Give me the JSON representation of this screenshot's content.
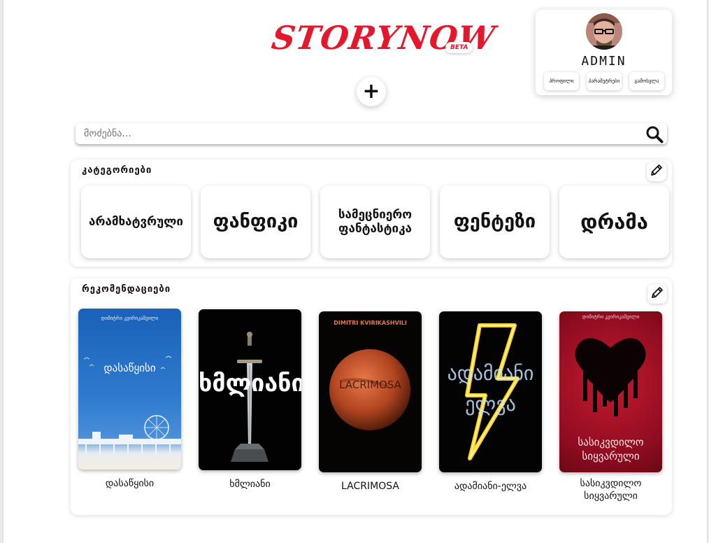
{
  "header": {
    "logo_text": "STORYNOW",
    "beta_label": "BETA",
    "add_button_label": "+"
  },
  "user": {
    "username": "ADMIN",
    "buttons": [
      "პროფილი",
      "პარამეტრები",
      "გამოსვლა"
    ]
  },
  "search": {
    "placeholder": "მოძებნა..."
  },
  "categories": {
    "title": "კატეგორიები",
    "items": [
      "არამხატვრული",
      "ფანფიკი",
      "სამეცნიერო ფანტასტიკა",
      "ფენტეზი",
      "დრამა"
    ]
  },
  "recommendations": {
    "title": "რეკომენდაციები",
    "books": [
      {
        "title": "დასაწყისი",
        "cover_author": "დიმიტრი კვირიკაშვილი",
        "cover_title": "დასაწყისი"
      },
      {
        "title": "ხმლიანი",
        "cover_title": "ხმლიანი"
      },
      {
        "title": "LACRIMOSA",
        "cover_author": "DIMITRI KVIRIKASHVILI",
        "cover_title": "LACRIMOSA"
      },
      {
        "title": "ადამიანი-ელვა",
        "cover_title_line1": "ადამიანი",
        "cover_title_line2": "ელვა"
      },
      {
        "title": "სასიკვდილო სიყვარული",
        "cover_author": "დიმიტრი კვირიკაშვილი",
        "cover_title_line1": "სასიკვდილო",
        "cover_title_line2": "სიყვარული"
      }
    ]
  },
  "colors": {
    "brand": "#e4172c",
    "background": "#ffffff",
    "page_margin": "#e9e9e9"
  }
}
